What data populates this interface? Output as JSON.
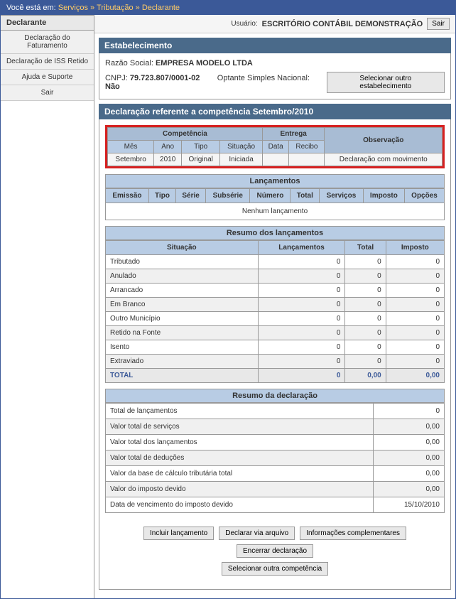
{
  "breadcrumb": {
    "prefix": "Você está em:",
    "items": [
      "Serviços",
      "Tributação",
      "Declarante"
    ]
  },
  "sidebar": {
    "active": "Declarante",
    "items": [
      "Declaração do Faturamento",
      "Declaração de ISS Retido",
      "Ajuda e Suporte",
      "Sair"
    ]
  },
  "userbar": {
    "label": "Usuário:",
    "user": "ESCRITÓRIO CONTÁBIL DEMONSTRAÇÃO",
    "exit": "Sair"
  },
  "estabelecimento": {
    "title": "Estabelecimento",
    "razao_label": "Razão Social:",
    "razao": "EMPRESA MODELO LTDA",
    "cnpj_label": "CNPJ:",
    "cnpj": "79.723.807/0001-02",
    "simples_label": "Optante Simples Nacional:",
    "simples": "Não",
    "btn": "Selecionar outro estabelecimento"
  },
  "declaracao": {
    "title": "Declaração referente a competência Setembro/2010"
  },
  "comp": {
    "h_comp": "Competência",
    "h_entrega": "Entrega",
    "h_obs": "Observação",
    "h_mes": "Mês",
    "h_ano": "Ano",
    "h_tipo": "Tipo",
    "h_situacao": "Situação",
    "h_data": "Data",
    "h_recibo": "Recibo",
    "mes": "Setembro",
    "ano": "2010",
    "tipo": "Original",
    "situacao": "Iniciada",
    "data": "",
    "recibo": "",
    "obs": "Declaração com movimento"
  },
  "lanc": {
    "title": "Lançamentos",
    "cols": [
      "Emissão",
      "Tipo",
      "Série",
      "Subsérie",
      "Número",
      "Total",
      "Serviços",
      "Imposto",
      "Opções"
    ],
    "empty": "Nenhum lançamento"
  },
  "resumo_lanc": {
    "title": "Resumo dos lançamentos",
    "cols": [
      "Situação",
      "Lançamentos",
      "Total",
      "Imposto"
    ],
    "rows": [
      {
        "label": "Tributado",
        "l": "0",
        "t": "0",
        "i": "0"
      },
      {
        "label": "Anulado",
        "l": "0",
        "t": "0",
        "i": "0"
      },
      {
        "label": "Arrancado",
        "l": "0",
        "t": "0",
        "i": "0"
      },
      {
        "label": "Em Branco",
        "l": "0",
        "t": "0",
        "i": "0"
      },
      {
        "label": "Outro Município",
        "l": "0",
        "t": "0",
        "i": "0"
      },
      {
        "label": "Retido na Fonte",
        "l": "0",
        "t": "0",
        "i": "0"
      },
      {
        "label": "Isento",
        "l": "0",
        "t": "0",
        "i": "0"
      },
      {
        "label": "Extraviado",
        "l": "0",
        "t": "0",
        "i": "0"
      }
    ],
    "total": {
      "label": "TOTAL",
      "l": "0",
      "t": "0,00",
      "i": "0,00"
    }
  },
  "resumo_dec": {
    "title": "Resumo da declaração",
    "rows": [
      {
        "label": "Total de lançamentos",
        "val": "0"
      },
      {
        "label": "Valor total de serviços",
        "val": "0,00"
      },
      {
        "label": "Valor total dos lançamentos",
        "val": "0,00"
      },
      {
        "label": "Valor total de deduções",
        "val": "0,00"
      },
      {
        "label": "Valor da base de cálculo tributária total",
        "val": "0,00"
      },
      {
        "label": "Valor do imposto devido",
        "val": "0,00"
      },
      {
        "label": "Data de vencimento do imposto devido",
        "val": "15/10/2010"
      }
    ]
  },
  "actions": {
    "incluir": "Incluir lançamento",
    "declarar": "Declarar via arquivo",
    "info": "Informações complementares",
    "encerrar": "Encerrar declaração",
    "selecionar": "Selecionar outra competência"
  }
}
